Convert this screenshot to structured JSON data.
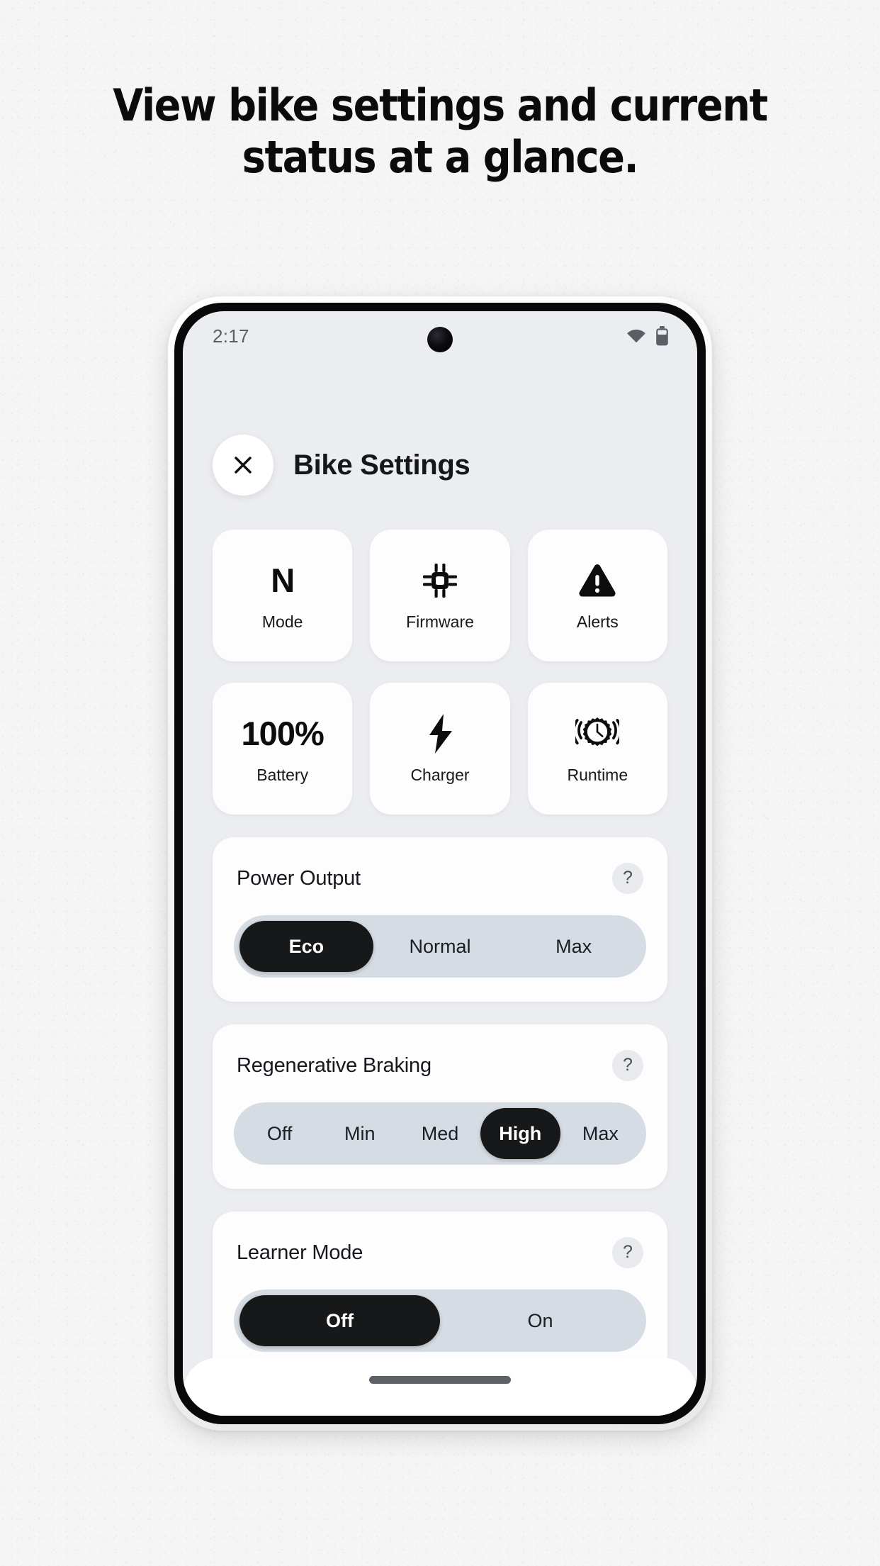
{
  "promo": {
    "headline_line1": "View bike settings and current",
    "headline_line2": "status at a glance."
  },
  "colors": {
    "page_background": "#f5f5f6",
    "screen_background": "#ecedf0",
    "card_background": "#fdfdfd",
    "segment_track": "#d6dce3",
    "segment_selected": "#17181a",
    "text_primary": "#16181c",
    "status_text": "#5a5f66",
    "help_badge_background": "#e8eaee",
    "gesture_pill": "#5e6167"
  },
  "status_bar": {
    "time": "2:17",
    "wifi_icon": "wifi-icon",
    "battery_icon": "battery-icon"
  },
  "header": {
    "close_icon": "close-icon",
    "title": "Bike Settings"
  },
  "stats": [
    {
      "value": "N",
      "icon": null,
      "label": "Mode"
    },
    {
      "value": null,
      "icon": "chip-icon",
      "label": "Firmware"
    },
    {
      "value": null,
      "icon": "warning-icon",
      "label": "Alerts"
    },
    {
      "value": "100%",
      "icon": null,
      "label": "Battery"
    },
    {
      "value": null,
      "icon": "bolt-icon",
      "label": "Charger"
    },
    {
      "value": null,
      "icon": "gear-clock-icon",
      "label": "Runtime"
    }
  ],
  "settings": [
    {
      "title": "Power Output",
      "help_label": "?",
      "options": [
        "Eco",
        "Normal",
        "Max"
      ],
      "selected": "Eco"
    },
    {
      "title": "Regenerative Braking",
      "help_label": "?",
      "options": [
        "Off",
        "Min",
        "Med",
        "High",
        "Max"
      ],
      "selected": "High"
    },
    {
      "title": "Learner Mode",
      "help_label": "?",
      "options": [
        "Off",
        "On"
      ],
      "selected": "Off"
    }
  ],
  "nav_bar": {
    "gesture_handle": "gesture-handle"
  }
}
